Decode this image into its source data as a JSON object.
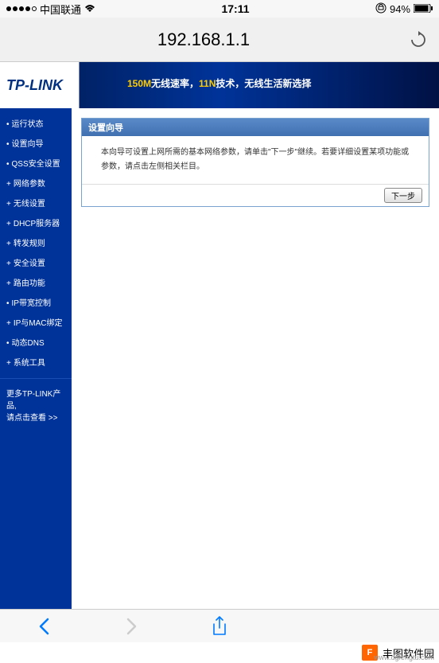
{
  "status": {
    "carrier": "中国联通",
    "time": "17:11",
    "battery": "94%"
  },
  "browser": {
    "url": "192.168.1.1"
  },
  "banner": {
    "logo": "TP-LINK",
    "slogan_prefix": "150M",
    "slogan_mid": "无线速率，",
    "slogan_tech": "11N",
    "slogan_suffix": "技术，无线生活新选择"
  },
  "sidebar": {
    "items": [
      {
        "label": "运行状态",
        "expand": false
      },
      {
        "label": "设置向导",
        "expand": false
      },
      {
        "label": "QSS安全设置",
        "expand": false
      },
      {
        "label": "网络参数",
        "expand": true
      },
      {
        "label": "无线设置",
        "expand": true
      },
      {
        "label": "DHCP服务器",
        "expand": true
      },
      {
        "label": "转发规则",
        "expand": true
      },
      {
        "label": "安全设置",
        "expand": true
      },
      {
        "label": "路由功能",
        "expand": true
      },
      {
        "label": "IP带宽控制",
        "expand": false
      },
      {
        "label": "IP与MAC绑定",
        "expand": true
      },
      {
        "label": "动态DNS",
        "expand": false
      },
      {
        "label": "系统工具",
        "expand": true
      }
    ],
    "more_line1": "更多TP-LINK产品,",
    "more_line2": "请点击查看 >>"
  },
  "wizard": {
    "title": "设置向导",
    "body": "本向导可设置上网所需的基本网络参数，请单击\"下一步\"继续。若要详细设置某项功能或参数，请点击左侧相关栏目。",
    "next_button": "下一步"
  },
  "watermark": {
    "text": "丰图软件园",
    "url": "www.dgfengtu.com"
  }
}
